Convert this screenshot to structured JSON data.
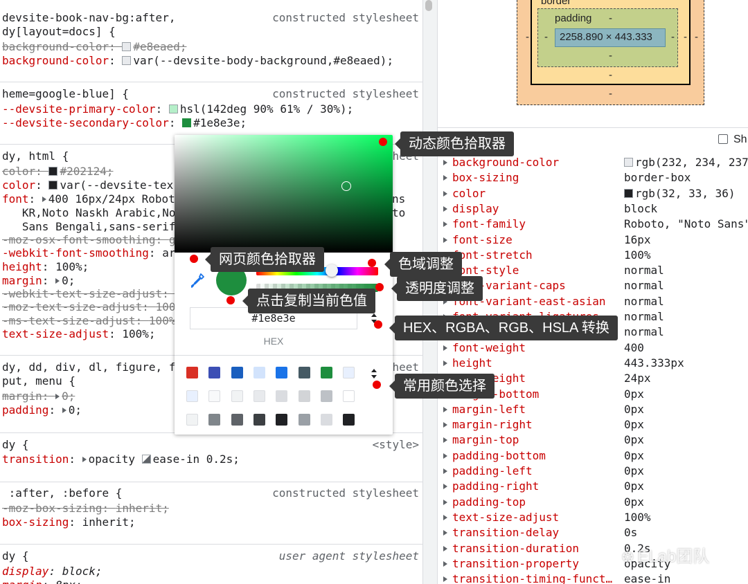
{
  "styles_pane": {
    "rule1": {
      "selector": "devsite-book-nav-bg:after,",
      "selector2": "dy[layout=docs] {",
      "source": "constructed stylesheet",
      "decls": [
        {
          "prop": "background-color",
          "value": "#e8eaed;",
          "swatch": "#e8eaed",
          "struck": true
        },
        {
          "prop": "background-color",
          "value": "var(--devsite-body-background,#e8eaed);",
          "swatch": "#e8eaed",
          "struck": false
        }
      ]
    },
    "rule2": {
      "selector": "heme=google-blue] {",
      "source": "constructed stylesheet",
      "decls": [
        {
          "prop": "--devsite-primary-color",
          "value": "hsl(142deg 90% 61% / 30%);",
          "swatch": "#b5efc9"
        },
        {
          "prop": "--devsite-secondary-color",
          "value": "#1e8e3e;",
          "swatch": "#1e8e3e"
        }
      ]
    },
    "rule3": {
      "selector": "dy, html {",
      "source": "heet",
      "decls": [
        {
          "prop": "color",
          "value": "#202124;",
          "swatch": "#202124",
          "struck": true
        },
        {
          "prop": "color",
          "value": "var(--devsite-tex",
          "swatch": "#202124",
          "struck": false
        },
        {
          "prop": "font",
          "value": "400 16px/24px Robot",
          "tail": "ns",
          "struck": false
        },
        {
          "prop": "",
          "value": "   KR,Noto Naskh Arabic,No",
          "tail": "to",
          "struck": false
        },
        {
          "prop": "",
          "value": "   Sans Bengali,sans-serif",
          "struck": false
        },
        {
          "prop": "-moz-osx-font-smoothing",
          "value": "g",
          "struck": true
        },
        {
          "prop": "-webkit-font-smoothing",
          "value": "ar",
          "struck": false
        },
        {
          "prop": "height",
          "value": "100%;",
          "struck": false
        },
        {
          "prop": "margin",
          "value": "0;",
          "struck": false
        },
        {
          "prop": "-webkit-text-size-adjust",
          "value": "",
          "struck": true
        },
        {
          "prop": "-moz-text-size-adjust",
          "value": "100",
          "struck": true
        },
        {
          "prop": "-ms-text-size-adjust",
          "value": "100%",
          "struck": true
        },
        {
          "prop": "text-size-adjust",
          "value": "100%;",
          "struck": false
        }
      ]
    },
    "rule4": {
      "selector": "dy, dd, div, dl, figure, f",
      "selector2": "put, menu {",
      "source": "heet",
      "decls": [
        {
          "prop": "margin",
          "value": "0;",
          "struck": true
        },
        {
          "prop": "padding",
          "value": "0;",
          "struck": false
        }
      ]
    },
    "rule5": {
      "selector": "dy {",
      "source": "<style>",
      "decls": [
        {
          "prop": "transition",
          "value": "opacity",
          "value2": "ease-in 0.2s;"
        }
      ]
    },
    "rule6": {
      "selector": " :after, :before {",
      "source": "constructed stylesheet",
      "decls": [
        {
          "prop": "-moz-box-sizing",
          "value": "inherit;",
          "struck": true
        },
        {
          "prop": "box-sizing",
          "value": "inherit;",
          "struck": false
        }
      ]
    },
    "rule7": {
      "selector": "dy {",
      "source": "user agent stylesheet",
      "decls": [
        {
          "prop": "display",
          "value": "block;"
        },
        {
          "prop": "margin",
          "value": "8px;"
        }
      ]
    }
  },
  "box_model": {
    "border_label": "border",
    "padding_label": "padding",
    "dash": "-",
    "content_size": "2258.890 × 443.333"
  },
  "computed": {
    "show_all_label": "Sh",
    "rows": [
      {
        "name": "background-color",
        "value": "rgb(232, 234, 237",
        "swatch": "#e8eaed"
      },
      {
        "name": "box-sizing",
        "value": "border-box"
      },
      {
        "name": "color",
        "value": "rgb(32, 33, 36)",
        "swatch": "#202124"
      },
      {
        "name": "display",
        "value": "block"
      },
      {
        "name": "font-family",
        "value": "Roboto, \"Noto Sans\""
      },
      {
        "name": "font-size",
        "value": "16px"
      },
      {
        "name": "font-stretch",
        "value": "100%"
      },
      {
        "name": "font-style",
        "value": "normal"
      },
      {
        "name": "font-variant-caps",
        "value": "normal"
      },
      {
        "name": "font-variant-east-asian",
        "value": "normal"
      },
      {
        "name": "font-variant-ligatures",
        "value": "normal"
      },
      {
        "name": "font-variant-numeric",
        "value": "normal"
      },
      {
        "name": "font-weight",
        "value": "400"
      },
      {
        "name": "height",
        "value": "443.333px"
      },
      {
        "name": "line-height",
        "value": "24px"
      },
      {
        "name": "margin-bottom",
        "value": "0px"
      },
      {
        "name": "margin-left",
        "value": "0px"
      },
      {
        "name": "margin-right",
        "value": "0px"
      },
      {
        "name": "margin-top",
        "value": "0px"
      },
      {
        "name": "padding-bottom",
        "value": "0px"
      },
      {
        "name": "padding-left",
        "value": "0px"
      },
      {
        "name": "padding-right",
        "value": "0px"
      },
      {
        "name": "padding-top",
        "value": "0px"
      },
      {
        "name": "text-size-adjust",
        "value": "100%"
      },
      {
        "name": "transition-delay",
        "value": "0s"
      },
      {
        "name": "transition-duration",
        "value": "0.2s"
      },
      {
        "name": "transition-property",
        "value": "opacity"
      },
      {
        "name": "transition-timing-funct…",
        "value": "ease-in"
      }
    ]
  },
  "color_picker": {
    "hex_value": "#1e8e3e",
    "format_label": "HEX",
    "current_color": "#1e8e3e",
    "palette": [
      "#d93025",
      "#3c4fb5",
      "#1a5fbf",
      "#d2e3fc",
      "#1a73e8",
      "#455a64",
      "#1e8e3e",
      "#e8f0fe",
      "#e8f0fe",
      "#f8f9fa",
      "#f1f3f4",
      "#e8eaed",
      "#dadce0",
      "#d2d4d7",
      "#bdc1c6",
      "#ffffff",
      "#f1f3f4",
      "#80868b",
      "#5f6368",
      "#3c4043",
      "#202124",
      "#9aa0a6",
      "#dadce0",
      "#202124"
    ]
  },
  "annotations": {
    "dynamic_picker": "动态颜色拾取器",
    "page_picker": "网页颜色拾取器",
    "hue": "色域调整",
    "alpha": "透明度调整",
    "copy": "点击复制当前色值",
    "convert": "HEX、RGBA、RGB、HSLA 转换",
    "common": "常用颜色选择"
  },
  "watermark": "ELab团队"
}
